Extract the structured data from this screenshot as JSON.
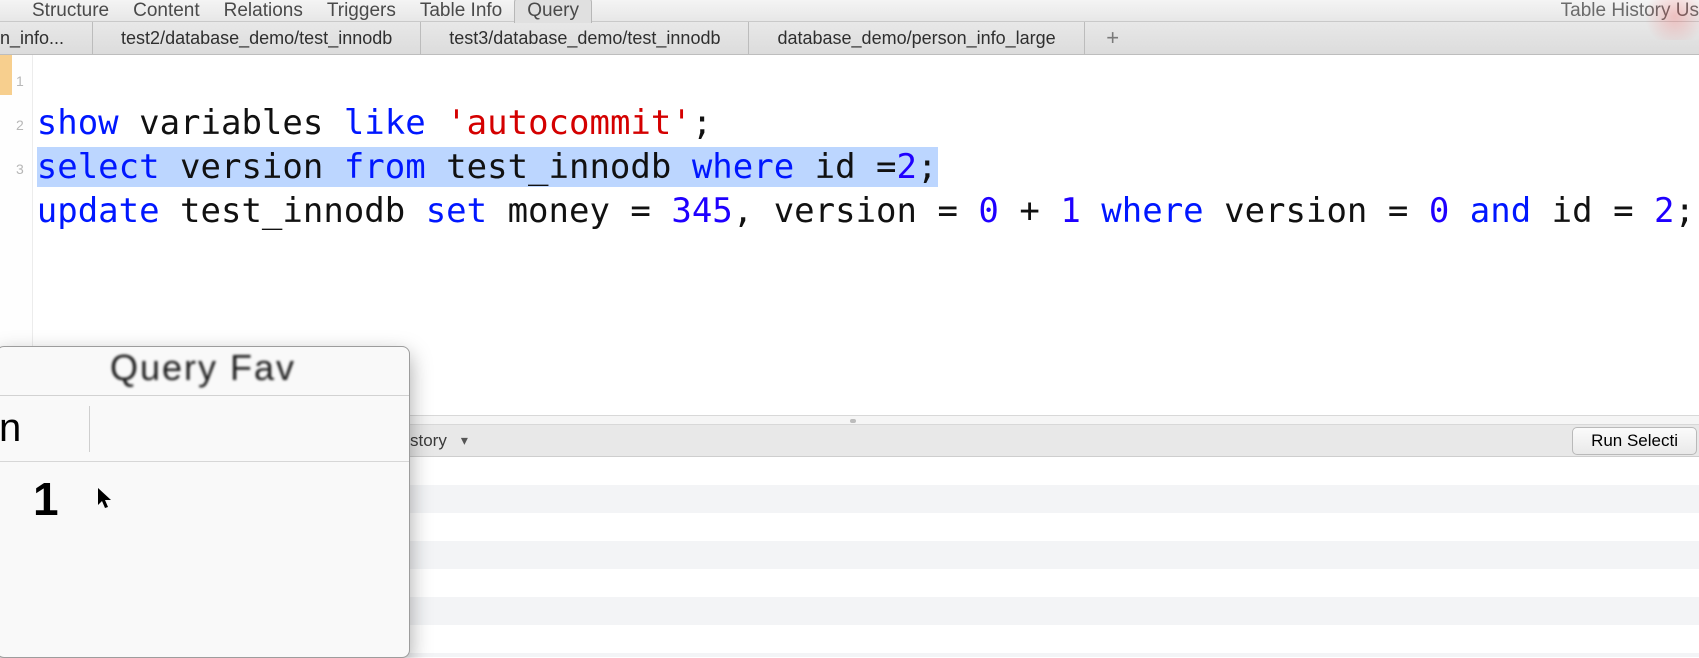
{
  "toolbar": {
    "items": [
      "Structure",
      "Content",
      "Relations",
      "Triggers",
      "Table Info",
      "Query"
    ],
    "active_index": 5,
    "right": "Table History   Us"
  },
  "tabs": {
    "items": [
      "n_info...",
      "test2/database_demo/test_innodb",
      "test3/database_demo/test_innodb",
      "database_demo/person_info_large"
    ],
    "plus": "+"
  },
  "sql": {
    "line_numbers": [
      "1",
      "2",
      "3"
    ],
    "l1": {
      "p0": "show",
      "p1": " variables ",
      "p2": "like",
      "p3": " ",
      "p4": "'autocommit'",
      "p5": ";"
    },
    "l2": {
      "p0": "select",
      "p1": " version ",
      "p2": "from",
      "p3": " test_innodb ",
      "p4": "where",
      "p5": " id =",
      "p6": "2",
      "p7": ";"
    },
    "l3": {
      "p0": "update",
      "p1": " test_innodb ",
      "p2": "set",
      "p3": " money = ",
      "p4": "345",
      "p5": ", version = ",
      "p6": "0",
      "p7": " + ",
      "p8": "1",
      "p9": " ",
      "p10": "where",
      "p11": " version = ",
      "p12": "0",
      "p13": " ",
      "p14": "and",
      "p15": " id = ",
      "p16": "2",
      "p17": ";"
    }
  },
  "runbar": {
    "dropdown_label": "story",
    "run_button": "Run Selecti"
  },
  "popup": {
    "title_fragment": "Query Fav",
    "col_header_fragment": "n",
    "cell_value": "1"
  }
}
